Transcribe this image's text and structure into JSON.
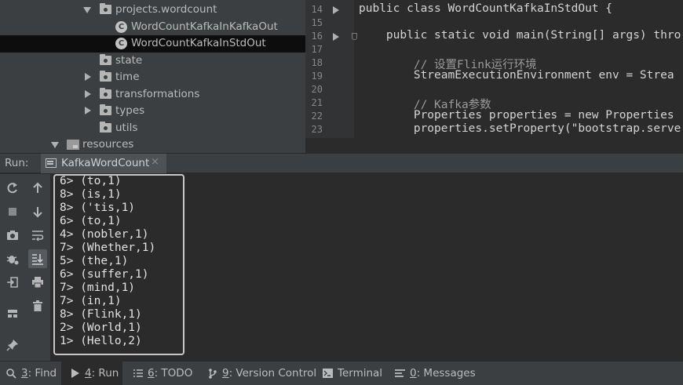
{
  "tree": {
    "items": [
      {
        "label": "projects.wordcount",
        "type": "package",
        "expanded": true
      },
      {
        "label": "WordCountKafkaInKafkaOut",
        "type": "class"
      },
      {
        "label": "WordCountKafkaInStdOut",
        "type": "class",
        "selected": true
      },
      {
        "label": "state",
        "type": "package"
      },
      {
        "label": "time",
        "type": "package",
        "collapsed": true
      },
      {
        "label": "transformations",
        "type": "package",
        "collapsed": true
      },
      {
        "label": "types",
        "type": "package",
        "collapsed": true
      },
      {
        "label": "utils",
        "type": "package"
      },
      {
        "label": "resources",
        "type": "resources",
        "expanded": true
      }
    ]
  },
  "editor": {
    "lines": [
      {
        "num": "14",
        "text": "public class WordCountKafkaInStdOut {"
      },
      {
        "num": "15",
        "text": ""
      },
      {
        "num": "16",
        "text": "    public static void main(String[] args) thro"
      },
      {
        "num": "17",
        "text": ""
      },
      {
        "num": "18",
        "text": "        // 设置Flink运行环境"
      },
      {
        "num": "19",
        "text": "        StreamExecutionEnvironment env = Strea"
      },
      {
        "num": "20",
        "text": ""
      },
      {
        "num": "21",
        "text": "        // Kafka参数"
      },
      {
        "num": "22",
        "text": "        Properties properties = new Properties"
      },
      {
        "num": "23",
        "text": "        properties.setProperty(\"bootstrap.serve"
      }
    ]
  },
  "run": {
    "label": "Run:",
    "tab_label": "KafkaWordCount",
    "tab_close": "×"
  },
  "console": {
    "lines": [
      "6> (to,1)",
      "8> (is,1)",
      "8> ('tis,1)",
      "6> (to,1)",
      "4> (nobler,1)",
      "7> (Whether,1)",
      "5> (the,1)",
      "6> (suffer,1)",
      "7> (mind,1)",
      "7> (in,1)",
      "8> (Flink,1)",
      "2> (World,1)",
      "1> (Hello,2)"
    ]
  },
  "status": {
    "items": [
      {
        "key": "3",
        "label": ": Find",
        "icon": "search-icon"
      },
      {
        "key": "4",
        "label": ": Run",
        "icon": "run-icon",
        "active": true
      },
      {
        "key": "6",
        "label": ": TODO",
        "icon": "list-icon"
      },
      {
        "key": "9",
        "label": ": Version Control",
        "icon": "branch-icon"
      },
      {
        "key": "",
        "label": "Terminal",
        "icon": "terminal-icon"
      },
      {
        "key": "0",
        "label": ": Messages",
        "icon": "messages-icon"
      }
    ]
  }
}
